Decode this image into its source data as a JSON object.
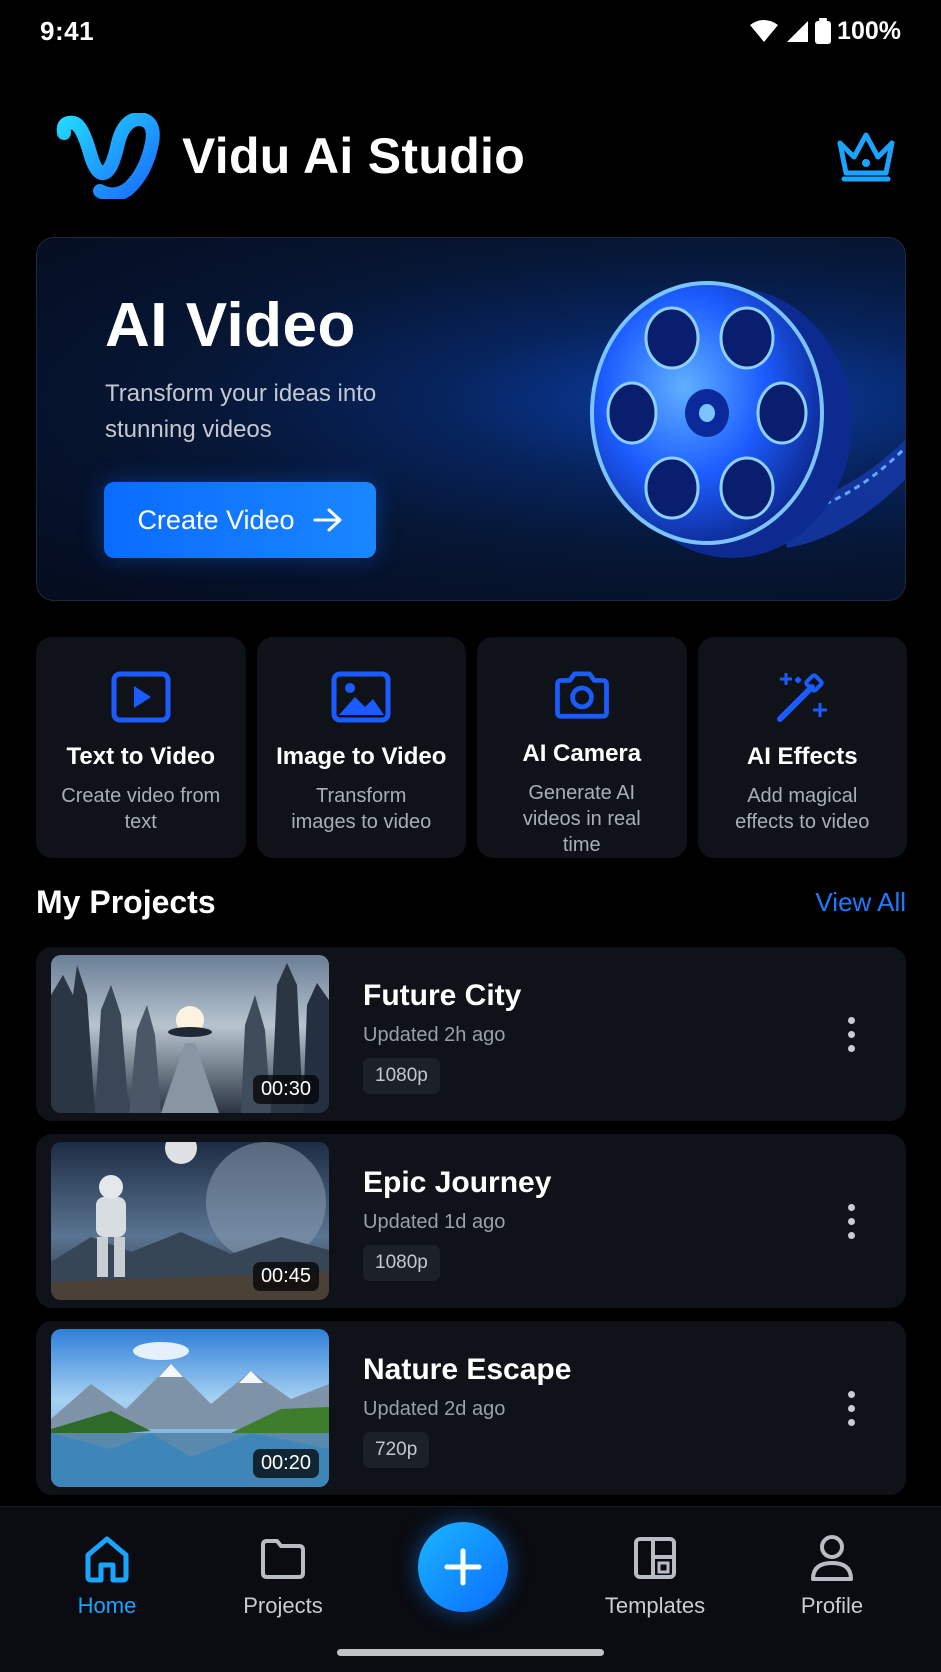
{
  "status_bar": {
    "time": "9:41",
    "battery": "100%"
  },
  "header": {
    "app_name": "Vidu Ai Studio",
    "logo_icon": "vidu-logo-icon",
    "premium_icon": "crown-icon"
  },
  "hero": {
    "title": "AI Video",
    "subtitle": "Transform your ideas into stunning videos",
    "button_label": "Create Video",
    "image": "film-reel-illustration"
  },
  "features": [
    {
      "title": "Text to Video",
      "description": "Create video from text",
      "icon": "play-square-icon"
    },
    {
      "title": "Image to Video",
      "description": "Transform images to video",
      "icon": "image-icon"
    },
    {
      "title": "AI Camera",
      "description": "Generate AI videos in real time",
      "icon": "camera-icon"
    },
    {
      "title": "AI Effects",
      "description": "Add magical effects to video",
      "icon": "magic-wand-icon"
    }
  ],
  "projects_section": {
    "title": "My Projects",
    "view_all": "View All"
  },
  "projects": [
    {
      "name": "Future City",
      "updated": "Updated 2h ago",
      "resolution": "1080p",
      "duration": "00:30"
    },
    {
      "name": "Epic Journey",
      "updated": "Updated 1d ago",
      "resolution": "1080p",
      "duration": "00:45"
    },
    {
      "name": "Nature Escape",
      "updated": "Updated 2d ago",
      "resolution": "720p",
      "duration": "00:20"
    }
  ],
  "nav": {
    "items": [
      {
        "label": "Home",
        "icon": "home-icon",
        "active": true
      },
      {
        "label": "Projects",
        "icon": "folder-icon"
      },
      {
        "label": "Templates",
        "icon": "templates-icon"
      },
      {
        "label": "Profile",
        "icon": "person-icon"
      }
    ],
    "fab_icon": "plus-icon"
  },
  "colors": {
    "accent": "#1a7bff",
    "active_nav": "#1aa3ff",
    "card": "#0f1218",
    "background": "#000000"
  }
}
